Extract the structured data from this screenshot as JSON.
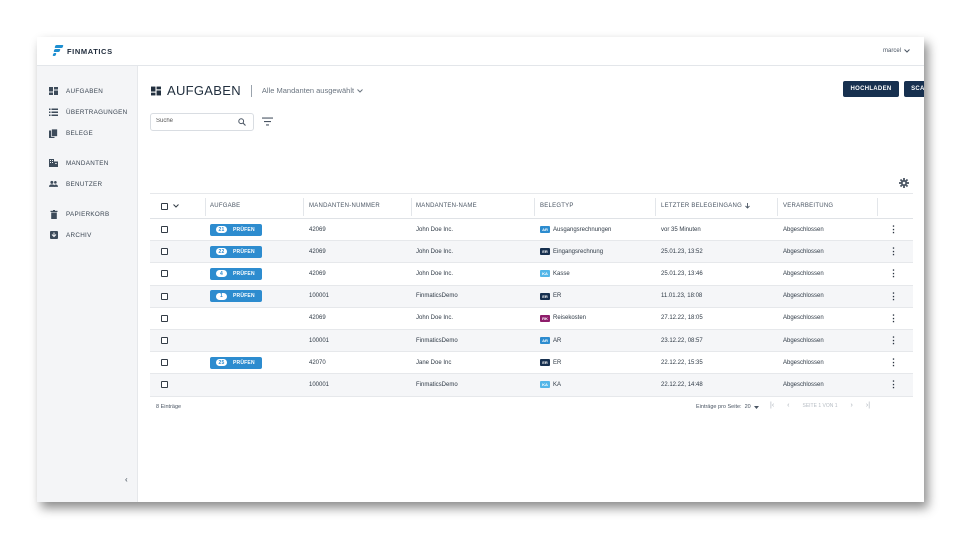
{
  "app": {
    "brand": "FINMATICS",
    "user": "marcel"
  },
  "sidebar": {
    "items": [
      {
        "label": "AUFGABEN",
        "icon": "dashboard-icon"
      },
      {
        "label": "ÜBERTRAGUNGEN",
        "icon": "list-icon"
      },
      {
        "label": "BELEGE",
        "icon": "documents-icon"
      },
      {
        "label": "MANDANTEN",
        "icon": "building-icon"
      },
      {
        "label": "BENUTZER",
        "icon": "users-icon"
      },
      {
        "label": "PAPIERKORB",
        "icon": "trash-icon"
      },
      {
        "label": "ARCHIV",
        "icon": "archive-icon"
      }
    ],
    "collapse": "‹"
  },
  "header": {
    "title": "AUFGABEN",
    "client_select": "Alle Mandanten ausgewählt",
    "upload_label": "HOCHLADEN",
    "scan_label": "SCANNEN"
  },
  "search": {
    "placeholder": "Suche"
  },
  "table": {
    "columns": [
      "AUFGABE",
      "MANDANTEN-NUMMER",
      "MANDANTEN-NAME",
      "BELEGTYP",
      "LETZTER BELEGEINGANG",
      "VERARBEITUNG"
    ],
    "task_label": "PRÜFEN",
    "rows": [
      {
        "task_count": "21",
        "number": "42069",
        "name": "John Doe Inc.",
        "type_code": "AR",
        "type_color": "#2d8ccf",
        "type": "Ausgangsrechnungen",
        "last": "vor 35 Minuten",
        "status": "Abgeschlossen"
      },
      {
        "task_count": "22",
        "number": "42069",
        "name": "John Doe Inc.",
        "type_code": "ER",
        "type_color": "#17304f",
        "type": "Eingangsrechnung",
        "last": "25.01.23, 13:52",
        "status": "Abgeschlossen"
      },
      {
        "task_count": "4",
        "number": "42069",
        "name": "John Doe Inc.",
        "type_code": "KA",
        "type_color": "#53b6e8",
        "type": "Kasse",
        "last": "25.01.23, 13:46",
        "status": "Abgeschlossen"
      },
      {
        "task_count": "1",
        "number": "100001",
        "name": "FinmaticsDemo",
        "type_code": "ER",
        "type_color": "#17304f",
        "type": "ER",
        "last": "11.01.23, 18:08",
        "status": "Abgeschlossen"
      },
      {
        "task_count": "",
        "number": "42069",
        "name": "John Doe Inc.",
        "type_code": "RK",
        "type_color": "#8e1d6b",
        "type": "Reisekosten",
        "last": "27.12.22, 18:05",
        "status": "Abgeschlossen"
      },
      {
        "task_count": "",
        "number": "100001",
        "name": "FinmaticsDemo",
        "type_code": "AR",
        "type_color": "#2d8ccf",
        "type": "AR",
        "last": "23.12.22, 08:57",
        "status": "Abgeschlossen"
      },
      {
        "task_count": "25",
        "number": "42070",
        "name": "Jane Doe Inc",
        "type_code": "ER",
        "type_color": "#17304f",
        "type": "ER",
        "last": "22.12.22, 15:35",
        "status": "Abgeschlossen"
      },
      {
        "task_count": "",
        "number": "100001",
        "name": "FinmaticsDemo",
        "type_code": "KA",
        "type_color": "#53b6e8",
        "type": "KA",
        "last": "22.12.22, 14:48",
        "status": "Abgeschlossen"
      }
    ]
  },
  "footer": {
    "count": "8 Einträge",
    "per_page_label": "Einträge pro Seite:",
    "per_page": "20",
    "page_info": "SEITE 1 VON 1"
  }
}
